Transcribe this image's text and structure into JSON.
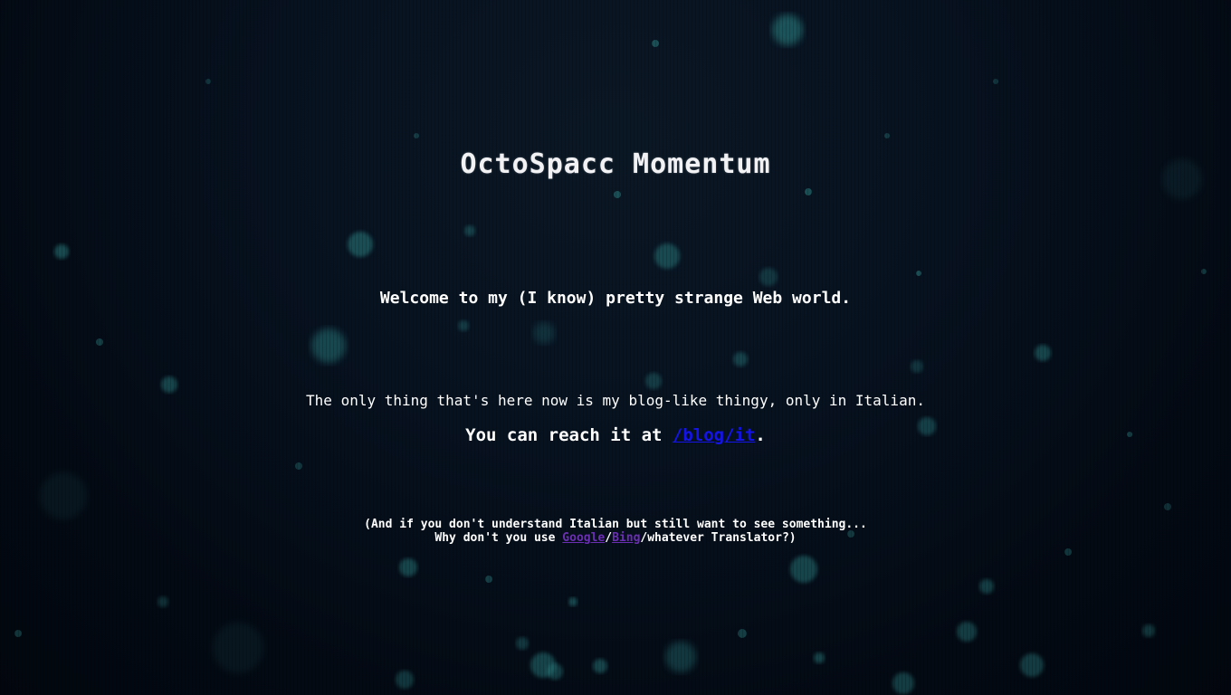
{
  "page": {
    "title": "OctoSpacc Momentum",
    "welcome": "Welcome to my (I know) pretty strange Web world.",
    "only_thing": "The only thing that's here now is my blog-like thingy, only in Italian.",
    "reach_prefix": "You can reach it at ",
    "blog_link": "/blog/it",
    "reach_suffix": ".",
    "note_line1": "(And if you don't understand Italian but still want to see something...",
    "note_line2_prefix": "Why don't you use ",
    "google_link": "Google",
    "slash": "/",
    "bing_link": "Bing",
    "note_line2_suffix": "/whatever Translator?)"
  },
  "colors": {
    "background": "#030a14",
    "text": "#ffffff",
    "link": "#1414e8",
    "visited_link": "#6b2fb3",
    "bokeh": "#2a8a8a"
  }
}
